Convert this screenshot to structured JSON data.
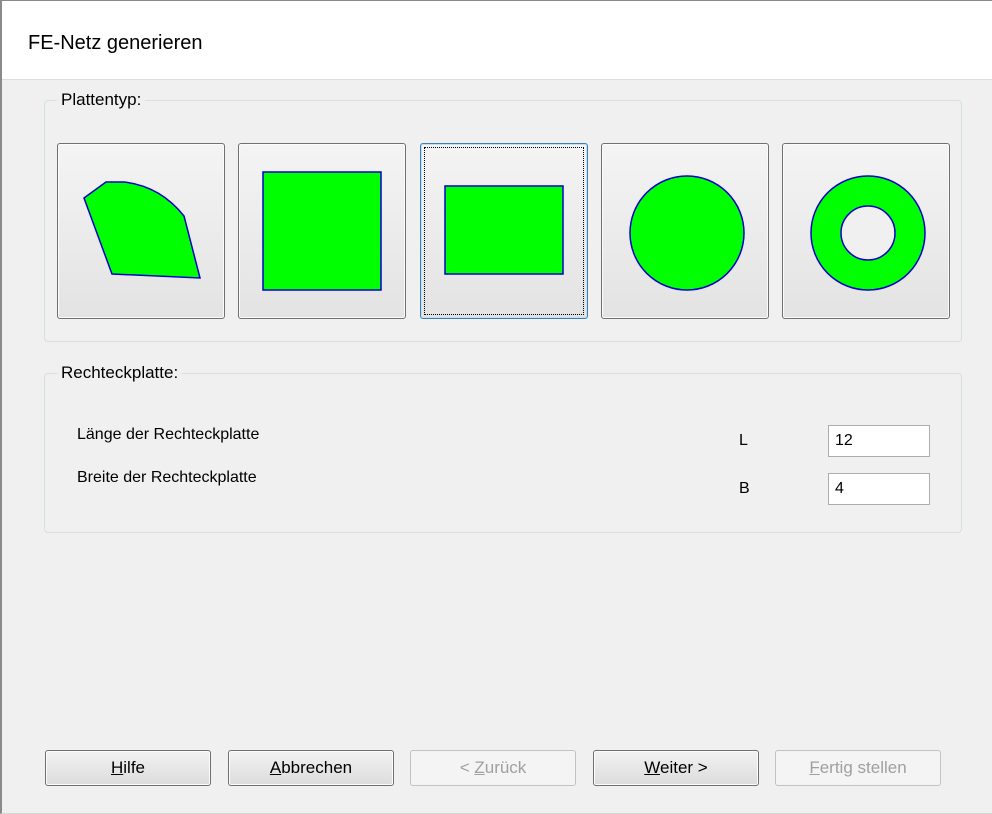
{
  "window": {
    "title": "FE-Netz generieren"
  },
  "plate_type": {
    "group_label": "Plattentyp:",
    "options": [
      {
        "name": "polygon"
      },
      {
        "name": "square"
      },
      {
        "name": "rectangle",
        "selected": true
      },
      {
        "name": "circle"
      },
      {
        "name": "ring"
      }
    ],
    "fill_color": "#00ff00",
    "stroke_color": "#0000cc"
  },
  "rect_plate": {
    "group_label": "Rechteckplatte:",
    "length_label": "Länge der Rechteckplatte",
    "length_symbol": "L",
    "length_value": "12",
    "width_label": "Breite der Rechteckplatte",
    "width_symbol": "B",
    "width_value": "4"
  },
  "buttons": {
    "help": {
      "mnemonic": "H",
      "rest": "ilfe"
    },
    "cancel": {
      "mnemonic": "A",
      "rest": "bbrechen"
    },
    "back": {
      "prefix": "< ",
      "mnemonic": "Z",
      "rest": "urück",
      "disabled": true
    },
    "next": {
      "mnemonic": "W",
      "rest": "eiter >"
    },
    "finish": {
      "mnemonic": "F",
      "rest": "ertig stellen",
      "disabled": true
    }
  }
}
